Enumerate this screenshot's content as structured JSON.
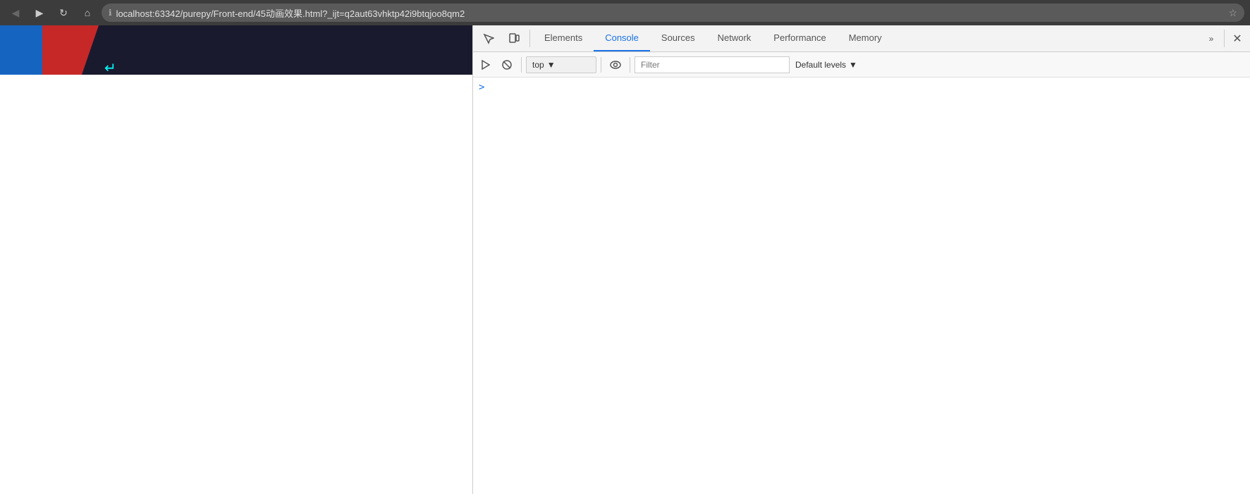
{
  "browser": {
    "back_btn": "◀",
    "forward_btn": "▶",
    "reload_btn": "↻",
    "home_btn": "⌂",
    "url": "localhost:63342/purepy/Front-end/45动画效果.html?_ijt=q2aut63vhktp42i9btqjoo8qm2",
    "star_icon": "☆"
  },
  "devtools": {
    "inspect_icon": "↖",
    "device_icon": "⬜",
    "tabs": [
      {
        "id": "elements",
        "label": "Elements",
        "active": false
      },
      {
        "id": "console",
        "label": "Console",
        "active": true
      },
      {
        "id": "sources",
        "label": "Sources",
        "active": false
      },
      {
        "id": "network",
        "label": "Network",
        "active": false
      },
      {
        "id": "performance",
        "label": "Performance",
        "active": false
      },
      {
        "id": "memory",
        "label": "Memory",
        "active": false
      }
    ],
    "more_label": "»",
    "console": {
      "run_icon": "▶",
      "clear_icon": "🚫",
      "context_label": "top",
      "context_dropdown": "▾",
      "eye_icon": "👁",
      "filter_placeholder": "Filter",
      "levels_label": "Default levels",
      "levels_dropdown": "▾",
      "prompt_chevron": ">"
    }
  }
}
